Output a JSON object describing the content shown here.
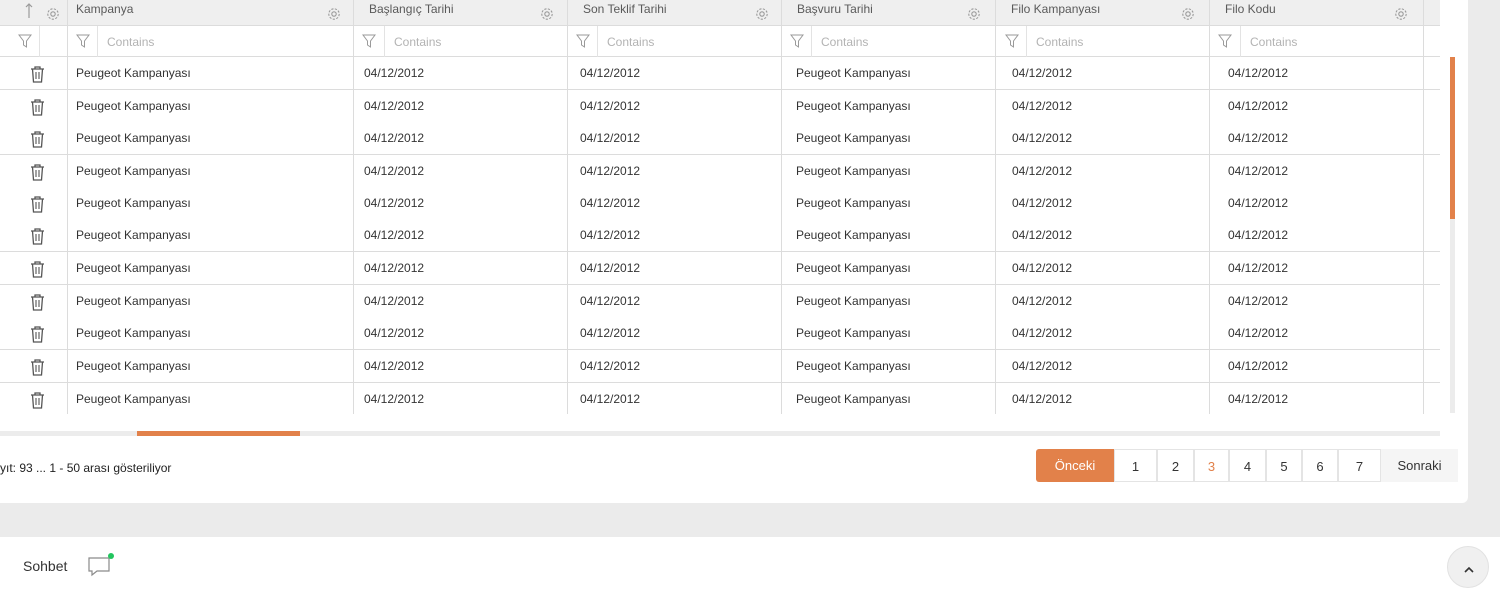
{
  "columns": [
    {
      "label": "Kampanya"
    },
    {
      "label": "Başlangıç Tarihi"
    },
    {
      "label": "Son Teklif Tarihi"
    },
    {
      "label": "Başvuru Tarihi"
    },
    {
      "label": "Filo Kampanyası"
    },
    {
      "label": "Filo Kodu"
    }
  ],
  "filter_placeholder": "Contains",
  "rows": [
    [
      "Peugeot Kampanyası",
      "04/12/2012",
      "04/12/2012",
      "Peugeot Kampanyası",
      "04/12/2012",
      "04/12/2012"
    ],
    [
      "Peugeot Kampanyası",
      "04/12/2012",
      "04/12/2012",
      "Peugeot Kampanyası",
      "04/12/2012",
      "04/12/2012"
    ],
    [
      "Peugeot Kampanyası",
      "04/12/2012",
      "04/12/2012",
      "Peugeot Kampanyası",
      "04/12/2012",
      "04/12/2012"
    ],
    [
      "Peugeot Kampanyası",
      "04/12/2012",
      "04/12/2012",
      "Peugeot Kampanyası",
      "04/12/2012",
      "04/12/2012"
    ],
    [
      "Peugeot Kampanyası",
      "04/12/2012",
      "04/12/2012",
      "Peugeot Kampanyası",
      "04/12/2012",
      "04/12/2012"
    ],
    [
      "Peugeot Kampanyası",
      "04/12/2012",
      "04/12/2012",
      "Peugeot Kampanyası",
      "04/12/2012",
      "04/12/2012"
    ],
    [
      "Peugeot Kampanyası",
      "04/12/2012",
      "04/12/2012",
      "Peugeot Kampanyası",
      "04/12/2012",
      "04/12/2012"
    ],
    [
      "Peugeot Kampanyası",
      "04/12/2012",
      "04/12/2012",
      "Peugeot Kampanyası",
      "04/12/2012",
      "04/12/2012"
    ],
    [
      "Peugeot Kampanyası",
      "04/12/2012",
      "04/12/2012",
      "Peugeot Kampanyası",
      "04/12/2012",
      "04/12/2012"
    ],
    [
      "Peugeot Kampanyası",
      "04/12/2012",
      "04/12/2012",
      "Peugeot Kampanyası",
      "04/12/2012",
      "04/12/2012"
    ],
    [
      "Peugeot Kampanyası",
      "04/12/2012",
      "04/12/2012",
      "Peugeot Kampanyası",
      "04/12/2012",
      "04/12/2012"
    ]
  ],
  "row_icon": "trash-icon",
  "header_icons": {
    "sort": "sort-up-icon",
    "settings": "gear-icon",
    "filter": "filter-icon"
  },
  "record_info": "yıt: 93 ... 1 - 50 arası gösteriliyor",
  "pagination": {
    "prev_label": "Önceki",
    "next_label": "Sonraki",
    "pages": [
      "1",
      "2",
      "3",
      "4",
      "5",
      "6",
      "7"
    ],
    "active_page": "3"
  },
  "footer": {
    "chat_label": "Sohbet",
    "chat_icon": "chat-bubble-icon",
    "chat_status_color": "#22c55e",
    "scroll_top_icon": "chevron-up-icon"
  },
  "colors": {
    "accent": "#e2814a",
    "border": "#dcdcdc",
    "header_bg": "#efefef"
  }
}
